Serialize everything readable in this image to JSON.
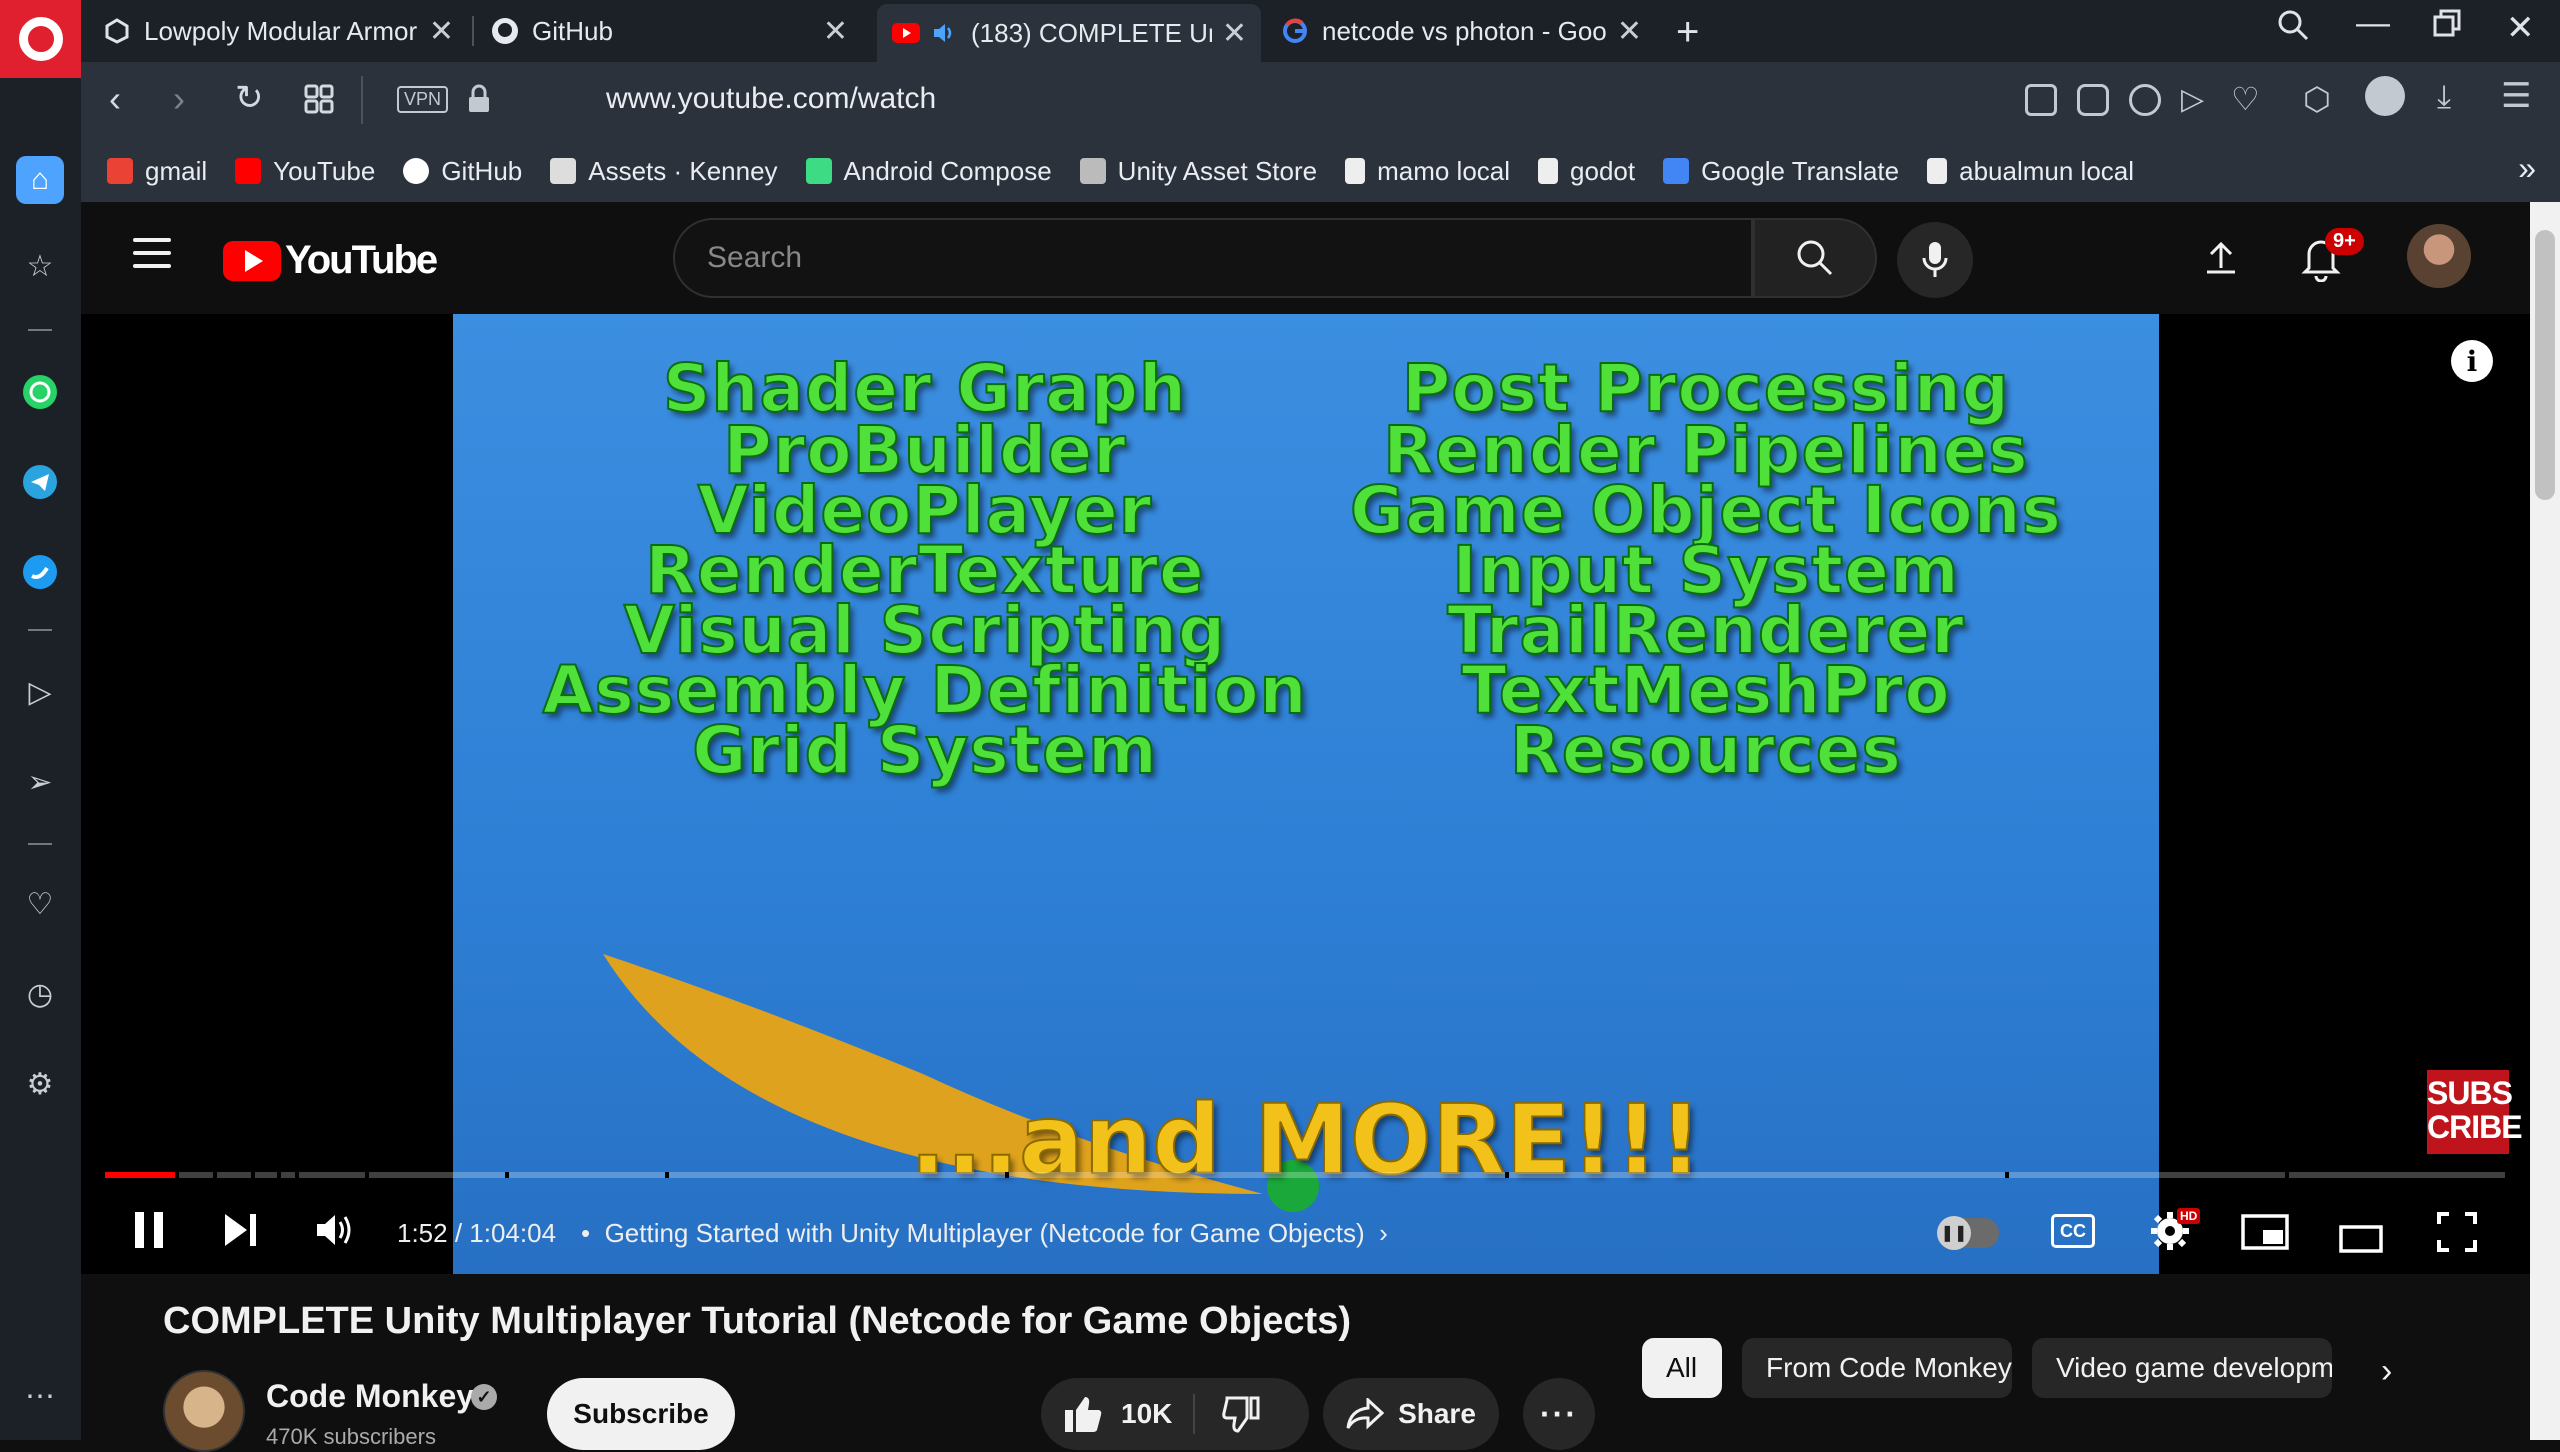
{
  "browser": {
    "tabs": [
      {
        "title": "Lowpoly Modular Armor"
      },
      {
        "title": "GitHub"
      },
      {
        "title": "(183) COMPLETE Uni"
      },
      {
        "title": "netcode vs photon - Goo"
      }
    ],
    "new_tab_label": "+",
    "url": "www.youtube.com/watch",
    "vpn_label": "VPN",
    "bookmarks": [
      {
        "label": "gmail",
        "color": "#ea4335"
      },
      {
        "label": "YouTube",
        "color": "#ff0000"
      },
      {
        "label": "GitHub",
        "color": "#ffffff"
      },
      {
        "label": "Assets · Kenney",
        "color": "#dddddd"
      },
      {
        "label": "Android Compose",
        "color": "#3ddc84"
      },
      {
        "label": "Unity Asset Store",
        "color": "#bbbbbb"
      },
      {
        "label": "mamo local",
        "color": "#eeeeee"
      },
      {
        "label": "godot",
        "color": "#eeeeee"
      },
      {
        "label": "Google Translate",
        "color": "#4285f4"
      },
      {
        "label": "abualmun local",
        "color": "#eeeeee"
      }
    ],
    "bookmarks_more": "»"
  },
  "youtube": {
    "search_placeholder": "Search",
    "notification_count": "9+",
    "logo_text": "YouTube",
    "video_frame": {
      "features_left": [
        "Shader Graph",
        "ProBuilder",
        "VideoPlayer",
        "RenderTexture",
        "Visual Scripting",
        "Assembly Definition",
        "Grid System"
      ],
      "features_right": [
        "Post Processing",
        "Render Pipelines",
        "Game Object Icons",
        "Input System",
        "TrailRenderer",
        "TextMeshPro",
        "Resources"
      ],
      "and_more": "...and MORE!!!",
      "subscribe_logo": "SUBS CRIBE"
    },
    "player": {
      "progress": 0.029,
      "current_time": "1:52",
      "duration": "1:04:04",
      "chapter": "Getting Started with Unity Multiplayer (Netcode for Game Objects)",
      "cc_label": "CC",
      "hd_label": "HD"
    },
    "video": {
      "title": "COMPLETE Unity Multiplayer Tutorial (Netcode for Game Objects)",
      "channel": "Code Monkey",
      "subscribers": "470K subscribers",
      "subscribe_label": "Subscribe",
      "likes": "10K",
      "share_label": "Share"
    },
    "chips": [
      "All",
      "From Code Monkey",
      "Video game developm"
    ]
  }
}
